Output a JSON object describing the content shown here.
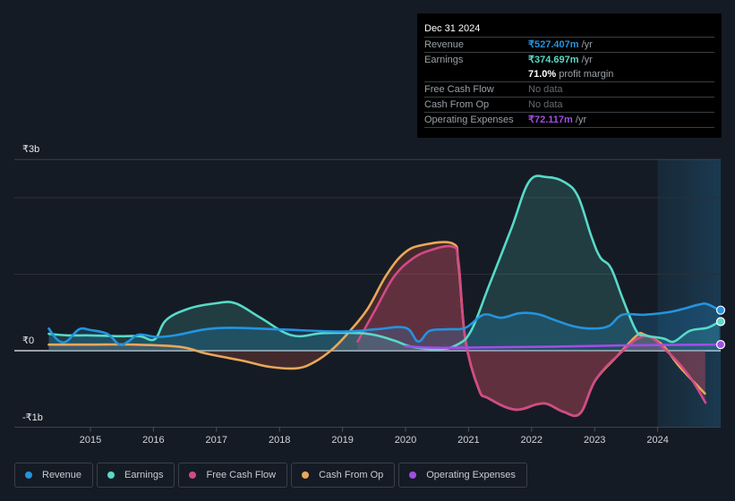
{
  "tooltip": {
    "date": "Dec 31 2024",
    "rows": [
      {
        "label": "Revenue",
        "value": "₹527.407m",
        "suffix": " /yr",
        "color": "#2394df"
      },
      {
        "label": "Earnings",
        "value": "₹374.697m",
        "suffix": " /yr",
        "color": "#58d9c9"
      },
      {
        "label": "",
        "value": "71.0%",
        "suffix": " profit margin",
        "color": "#ffffff"
      },
      {
        "label": "Free Cash Flow",
        "value": "No data",
        "suffix": "",
        "color": "#666a70"
      },
      {
        "label": "Cash From Op",
        "value": "No data",
        "suffix": "",
        "color": "#666a70"
      },
      {
        "label": "Operating Expenses",
        "value": "₹72.117m",
        "suffix": " /yr",
        "color": "#a24de6"
      }
    ]
  },
  "legend": [
    {
      "label": "Revenue",
      "color": "#2394df"
    },
    {
      "label": "Earnings",
      "color": "#58d9c9"
    },
    {
      "label": "Free Cash Flow",
      "color": "#d24a86"
    },
    {
      "label": "Cash From Op",
      "color": "#e8a85a"
    },
    {
      "label": "Operating Expenses",
      "color": "#a24de6"
    }
  ],
  "chart_data": {
    "type": "area",
    "title": "",
    "xlabel": "",
    "ylabel": "",
    "currency": "₹",
    "x_ticks": [
      2015,
      2016,
      2017,
      2018,
      2019,
      2020,
      2021,
      2022,
      2023,
      2024
    ],
    "y_tick_labels": [
      {
        "label": "₹3b",
        "value": 2.5
      },
      {
        "label": "₹0",
        "value": 0
      },
      {
        "label": "-₹1b",
        "value": -1
      }
    ],
    "ylim": [
      -1,
      2.5
    ],
    "xlim": [
      2013.8,
      2024.98
    ],
    "gridlines": [
      2.5,
      2,
      1,
      0,
      -1
    ],
    "highlight_region": [
      2024.0,
      2024.98
    ],
    "series": [
      {
        "name": "Revenue",
        "color": "#2394df",
        "points": [
          [
            2014.34,
            0.29
          ],
          [
            2014.48,
            0.14
          ],
          [
            2014.62,
            0.12
          ],
          [
            2014.82,
            0.28
          ],
          [
            2015.0,
            0.27
          ],
          [
            2015.27,
            0.22
          ],
          [
            2015.46,
            0.08
          ],
          [
            2015.6,
            0.12
          ],
          [
            2015.77,
            0.21
          ],
          [
            2016.05,
            0.18
          ],
          [
            2016.34,
            0.2
          ],
          [
            2016.83,
            0.28
          ],
          [
            2017.26,
            0.3
          ],
          [
            2017.97,
            0.28
          ],
          [
            2019.0,
            0.25
          ],
          [
            2019.53,
            0.28
          ],
          [
            2020.0,
            0.3
          ],
          [
            2020.2,
            0.12
          ],
          [
            2020.38,
            0.26
          ],
          [
            2020.67,
            0.28
          ],
          [
            2020.95,
            0.3
          ],
          [
            2021.24,
            0.47
          ],
          [
            2021.52,
            0.43
          ],
          [
            2021.81,
            0.49
          ],
          [
            2022.09,
            0.48
          ],
          [
            2022.37,
            0.4
          ],
          [
            2022.66,
            0.32
          ],
          [
            2022.94,
            0.29
          ],
          [
            2023.22,
            0.32
          ],
          [
            2023.44,
            0.47
          ],
          [
            2023.79,
            0.47
          ],
          [
            2024.22,
            0.51
          ],
          [
            2024.64,
            0.6
          ],
          [
            2024.78,
            0.61
          ],
          [
            2024.98,
            0.53
          ]
        ]
      },
      {
        "name": "Earnings",
        "color": "#58d9c9",
        "points": [
          [
            2014.34,
            0.22
          ],
          [
            2014.65,
            0.2
          ],
          [
            2015.0,
            0.2
          ],
          [
            2015.43,
            0.19
          ],
          [
            2015.78,
            0.19
          ],
          [
            2016.02,
            0.15
          ],
          [
            2016.2,
            0.4
          ],
          [
            2016.56,
            0.55
          ],
          [
            2016.99,
            0.62
          ],
          [
            2017.3,
            0.62
          ],
          [
            2017.7,
            0.43
          ],
          [
            2018.2,
            0.2
          ],
          [
            2018.69,
            0.23
          ],
          [
            2019.26,
            0.23
          ],
          [
            2019.54,
            0.2
          ],
          [
            2019.83,
            0.13
          ],
          [
            2020.11,
            0.05
          ],
          [
            2020.54,
            0.02
          ],
          [
            2020.82,
            0.08
          ],
          [
            2021.04,
            0.26
          ],
          [
            2021.32,
            0.84
          ],
          [
            2021.68,
            1.6
          ],
          [
            2021.96,
            2.21
          ],
          [
            2022.24,
            2.27
          ],
          [
            2022.53,
            2.2
          ],
          [
            2022.74,
            2.01
          ],
          [
            2022.95,
            1.49
          ],
          [
            2023.09,
            1.22
          ],
          [
            2023.26,
            1.08
          ],
          [
            2023.45,
            0.67
          ],
          [
            2023.66,
            0.26
          ],
          [
            2023.8,
            0.2
          ],
          [
            2024.09,
            0.16
          ],
          [
            2024.26,
            0.12
          ],
          [
            2024.51,
            0.26
          ],
          [
            2024.79,
            0.3
          ],
          [
            2024.98,
            0.38
          ]
        ]
      },
      {
        "name": "Free Cash Flow",
        "color": "#d24a86",
        "points": [
          [
            2019.24,
            0.12
          ],
          [
            2019.53,
            0.55
          ],
          [
            2019.81,
            0.96
          ],
          [
            2020.09,
            1.19
          ],
          [
            2020.38,
            1.31
          ],
          [
            2020.74,
            1.36
          ],
          [
            2020.84,
            1.17
          ],
          [
            2020.95,
            0.14
          ],
          [
            2021.16,
            -0.5
          ],
          [
            2021.31,
            -0.62
          ],
          [
            2021.73,
            -0.77
          ],
          [
            2022.09,
            -0.7
          ],
          [
            2022.26,
            -0.7
          ],
          [
            2022.51,
            -0.8
          ],
          [
            2022.77,
            -0.82
          ],
          [
            2023.01,
            -0.39
          ],
          [
            2023.36,
            -0.07
          ],
          [
            2023.79,
            0.19
          ],
          [
            2024.15,
            -0.01
          ],
          [
            2024.5,
            -0.33
          ],
          [
            2024.76,
            -0.68
          ]
        ]
      },
      {
        "name": "Cash From Op",
        "color": "#e8a85a",
        "points": [
          [
            2014.34,
            0.08
          ],
          [
            2015.0,
            0.08
          ],
          [
            2015.71,
            0.08
          ],
          [
            2016.42,
            0.05
          ],
          [
            2016.85,
            -0.04
          ],
          [
            2017.41,
            -0.13
          ],
          [
            2017.84,
            -0.21
          ],
          [
            2018.27,
            -0.23
          ],
          [
            2018.55,
            -0.15
          ],
          [
            2018.84,
            0.02
          ],
          [
            2019.12,
            0.26
          ],
          [
            2019.4,
            0.55
          ],
          [
            2019.69,
            0.98
          ],
          [
            2019.97,
            1.27
          ],
          [
            2020.26,
            1.38
          ],
          [
            2020.75,
            1.4
          ],
          [
            2020.84,
            1.13
          ],
          [
            2020.95,
            0.14
          ],
          [
            2021.16,
            -0.5
          ],
          [
            2021.31,
            -0.62
          ],
          [
            2021.73,
            -0.77
          ],
          [
            2022.09,
            -0.7
          ],
          [
            2022.26,
            -0.7
          ],
          [
            2022.51,
            -0.8
          ],
          [
            2022.77,
            -0.82
          ],
          [
            2023.01,
            -0.39
          ],
          [
            2023.36,
            -0.07
          ],
          [
            2023.67,
            0.2
          ],
          [
            2023.79,
            0.21
          ],
          [
            2024.07,
            0.08
          ],
          [
            2024.35,
            -0.21
          ],
          [
            2024.75,
            -0.56
          ]
        ]
      },
      {
        "name": "Operating Expenses",
        "color": "#a24de6",
        "points": [
          [
            2020.0,
            0.06
          ],
          [
            2020.38,
            0.04
          ],
          [
            2020.95,
            0.04
          ],
          [
            2022.09,
            0.05
          ],
          [
            2023.51,
            0.07
          ],
          [
            2024.98,
            0.08
          ]
        ]
      }
    ]
  }
}
